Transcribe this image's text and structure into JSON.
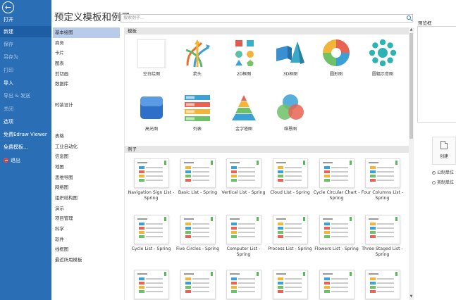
{
  "sidebar": {
    "items": [
      {
        "label": "打开",
        "active": false,
        "dim": false
      },
      {
        "label": "新建",
        "active": true,
        "dim": false
      },
      {
        "label": "保存",
        "active": false,
        "dim": true
      },
      {
        "label": "另存为",
        "active": false,
        "dim": true
      },
      {
        "label": "打印",
        "active": false,
        "dim": true
      },
      {
        "label": "导入",
        "active": false,
        "dim": false
      },
      {
        "label": "导出 & 发送",
        "active": false,
        "dim": true
      },
      {
        "label": "关闭",
        "active": false,
        "dim": true
      },
      {
        "label": "选项",
        "active": false,
        "dim": false
      },
      {
        "label": "免费Edraw Viewer",
        "active": false,
        "dim": false
      },
      {
        "label": "免费模板...",
        "active": false,
        "dim": false
      },
      {
        "label": "退出",
        "active": false,
        "dim": false
      }
    ]
  },
  "page_title": "预定义模板和例子",
  "search": {
    "placeholder": "搜索例子..."
  },
  "categories": [
    "基本绘图",
    "商务",
    "卡片",
    "图表",
    "剪切画",
    "数据库",
    "",
    "时装设计",
    "",
    "",
    "表格",
    "工业自动化",
    "信息图",
    "地图",
    "思维导图",
    "网络图",
    "组织结构图",
    "演示",
    "项目管理",
    "科学",
    "软件",
    "线框图",
    "最近所用模板"
  ],
  "templates_header": "模板",
  "templates": [
    {
      "label": "空白绘图",
      "icon": "blank-canvas-icon"
    },
    {
      "label": "箭头",
      "icon": "arrows-icon"
    },
    {
      "label": "2D框图",
      "icon": "2d-block-icon"
    },
    {
      "label": "3D框图",
      "icon": "3d-block-icon"
    },
    {
      "label": "圆形图",
      "icon": "circle-diagram-icon"
    },
    {
      "label": "圆辐示意图",
      "icon": "spoke-diagram-icon"
    },
    {
      "label": "高光图",
      "icon": "highlight-icon"
    },
    {
      "label": "列表",
      "icon": "list-icon"
    },
    {
      "label": "金字塔图",
      "icon": "pyramid-icon"
    },
    {
      "label": "维恩图",
      "icon": "venn-icon"
    }
  ],
  "examples_header": "例子",
  "examples": [
    {
      "label": "Navigation Sign List - Spring"
    },
    {
      "label": "Basic List - Spring"
    },
    {
      "label": "Vertical List - Spring"
    },
    {
      "label": "Cloud List - Spring"
    },
    {
      "label": "Cycle Circular Chart - Spring"
    },
    {
      "label": "Four Columns List - Spring"
    },
    {
      "label": "Cycle List - Spring"
    },
    {
      "label": "Five Circles - Spring"
    },
    {
      "label": "Computer List - Spring"
    },
    {
      "label": "Process List - Spring"
    },
    {
      "label": "Flowers List - Spring"
    },
    {
      "label": "Three Staged List - Spring"
    },
    {
      "label": ""
    },
    {
      "label": ""
    },
    {
      "label": ""
    },
    {
      "label": ""
    },
    {
      "label": ""
    },
    {
      "label": ""
    }
  ],
  "preview": {
    "title": "预览框"
  },
  "create_label": "创建",
  "units": {
    "metric": "公制单位",
    "imperial": "英制单位",
    "selected": "metric"
  },
  "colors": {
    "nav": "#2a6fb5",
    "nav_active": "#1c5da3",
    "category_active": "#b8cbea"
  }
}
